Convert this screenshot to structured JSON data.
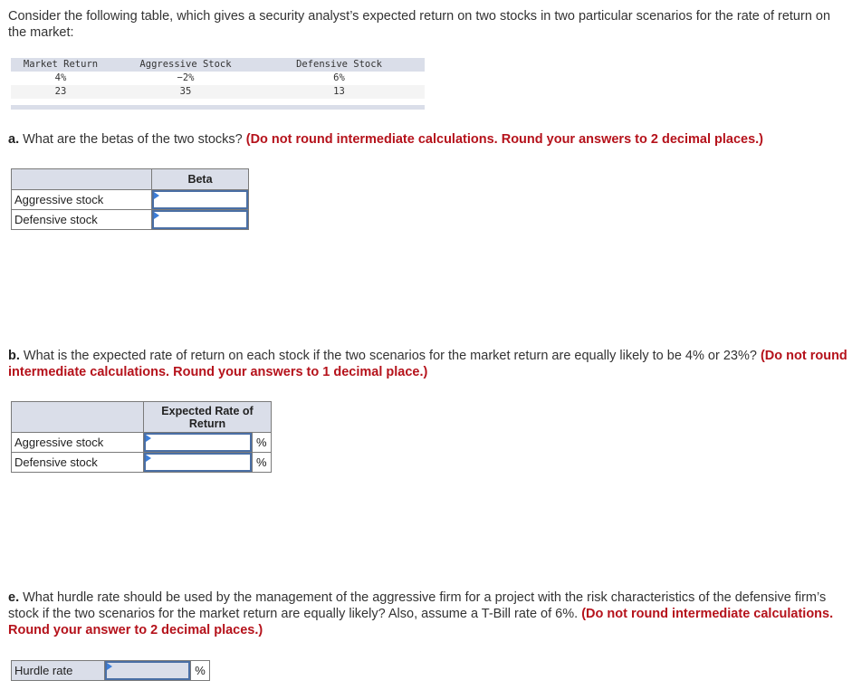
{
  "intro": "Consider the following table, which gives a security analyst’s expected return on two stocks in two particular scenarios for the rate of return on the market:",
  "data_table": {
    "headers": [
      "Market Return",
      "Aggressive Stock",
      "Defensive Stock"
    ],
    "rows": [
      [
        "4%",
        "−2%",
        "6%"
      ],
      [
        "23",
        "35",
        "13"
      ]
    ]
  },
  "part_a": {
    "label": "a.",
    "question": " What are the betas of the two stocks? ",
    "instruction": "(Do not round intermediate calculations. Round your answers to 2 decimal places.)",
    "table": {
      "column_header": "Beta",
      "rows": [
        {
          "label": "Aggressive stock",
          "value": ""
        },
        {
          "label": "Defensive stock",
          "value": ""
        }
      ]
    }
  },
  "part_b": {
    "label": "b.",
    "question": " What is the expected rate of return on each stock if the two scenarios for the market return are equally likely to be 4% or 23%? ",
    "instruction": "(Do not round intermediate calculations. Round your answers to 1 decimal place.)",
    "table": {
      "column_header": "Expected Rate of Return",
      "unit": "%",
      "rows": [
        {
          "label": "Aggressive stock",
          "value": ""
        },
        {
          "label": "Defensive stock",
          "value": ""
        }
      ]
    }
  },
  "part_e": {
    "label": "e.",
    "question": " What hurdle rate should be used by the management of the aggressive firm for a project with the risk characteristics of the defensive firm’s stock if the two scenarios for the market return are equally likely? Also, assume a T-Bill rate of 6%. ",
    "instruction": "(Do not round intermediate calculations. Round your answer to 2 decimal places.)",
    "table": {
      "label": "Hurdle rate",
      "value": "",
      "unit": "%"
    }
  }
}
